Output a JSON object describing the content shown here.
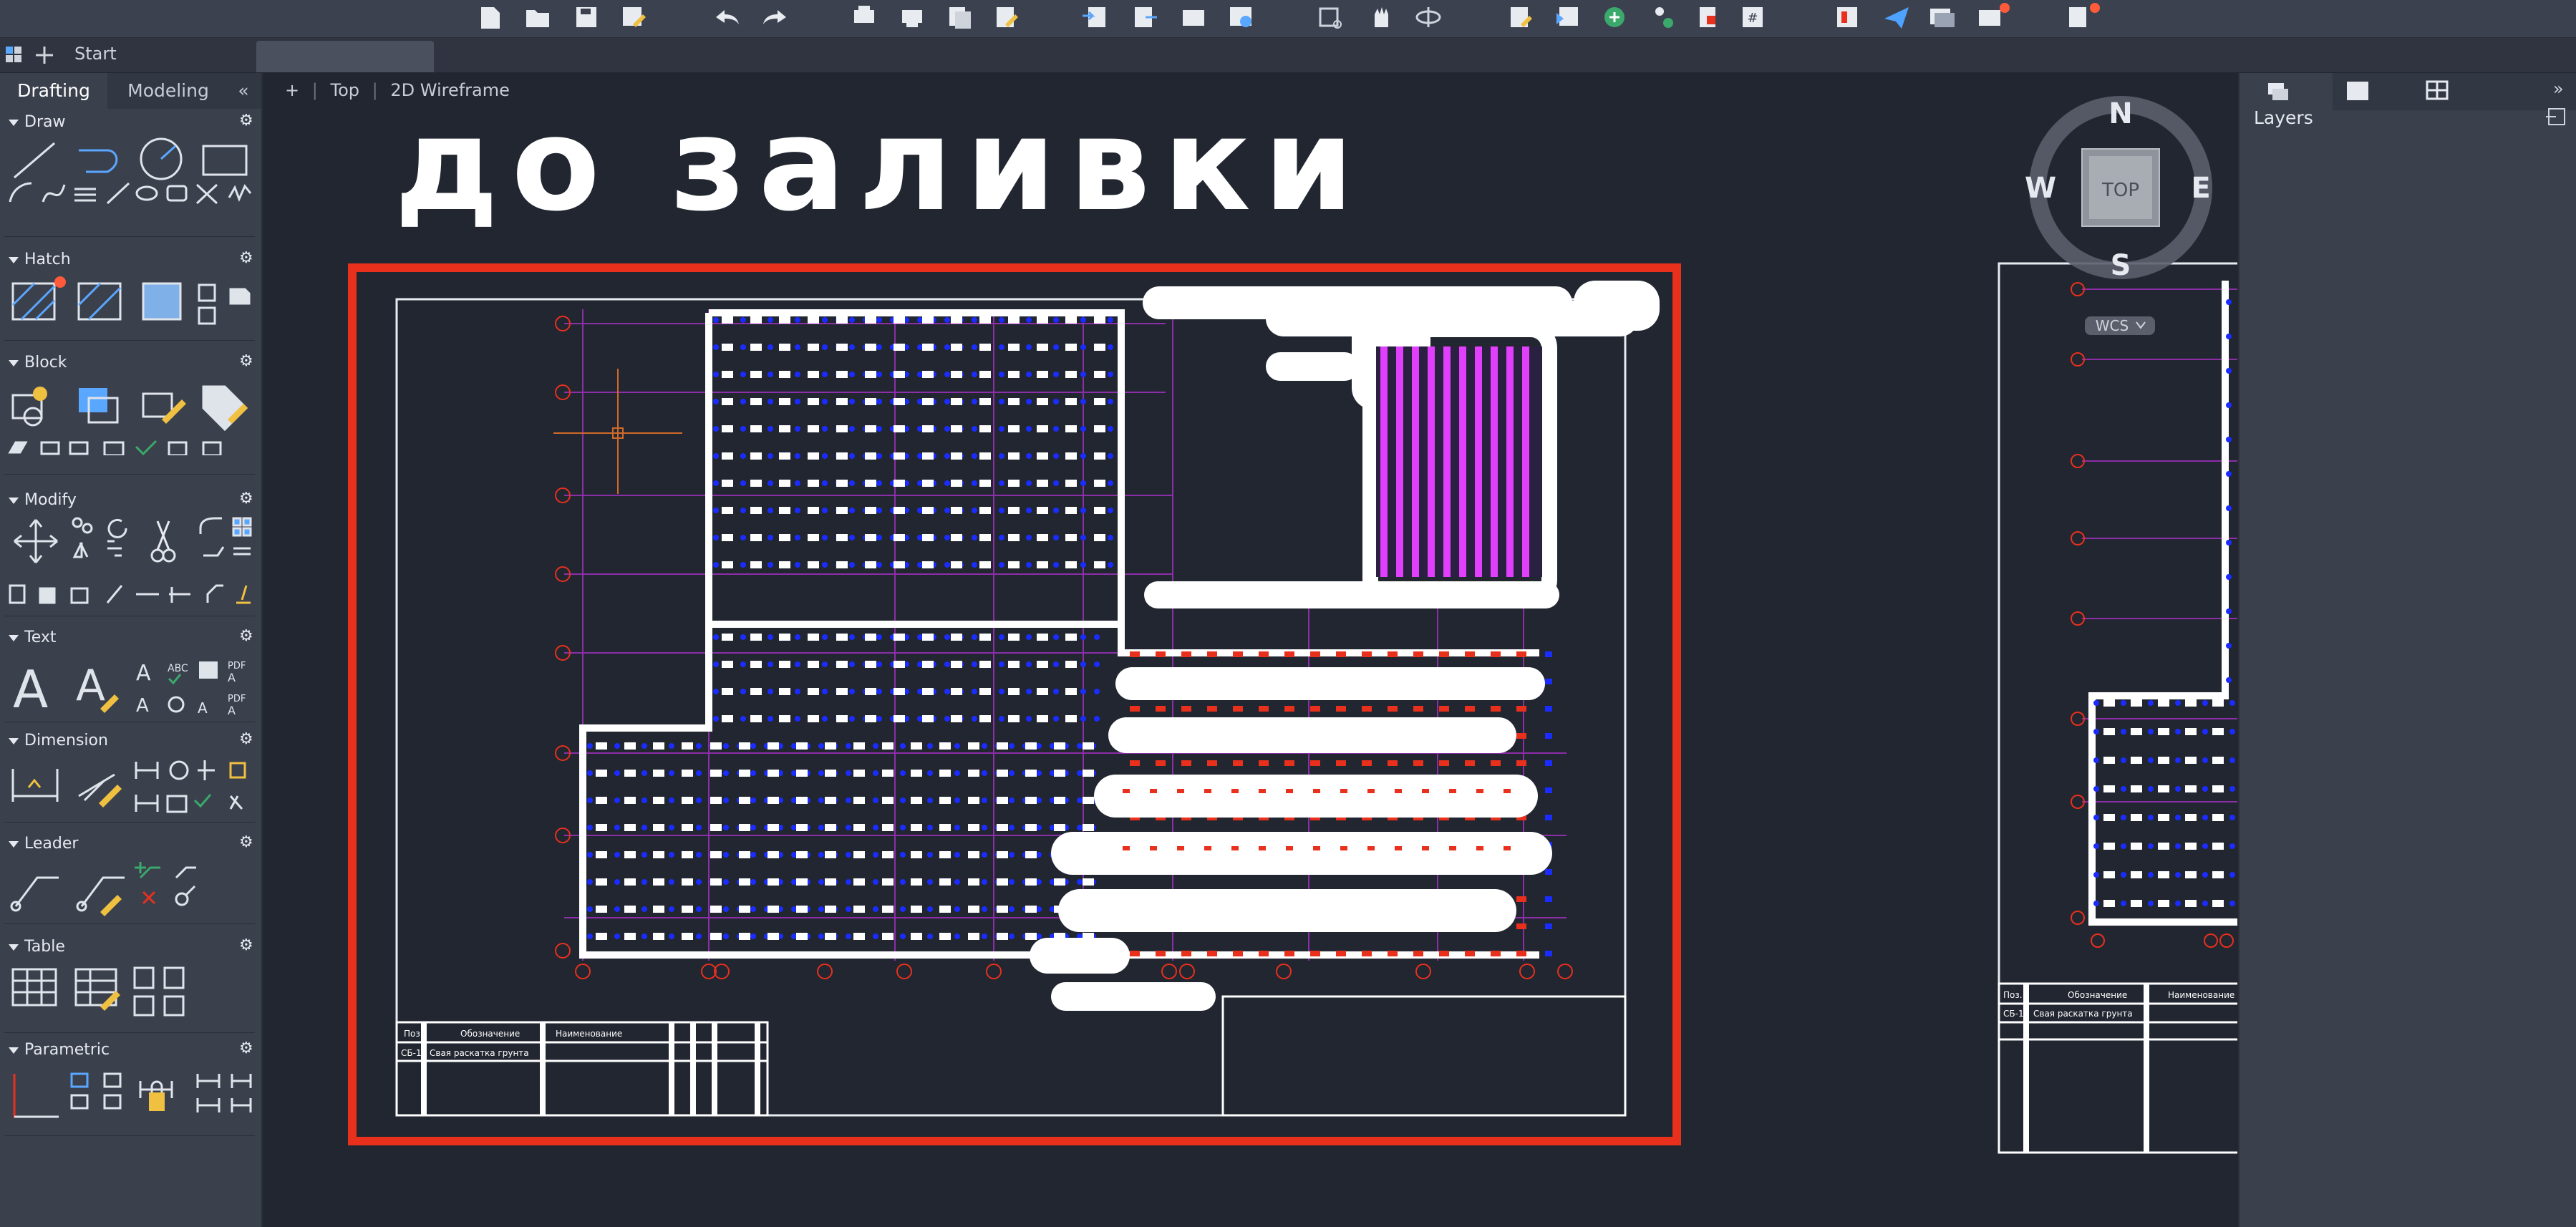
{
  "toolbar": {
    "icons": [
      "new-icon",
      "open-icon",
      "save-icon",
      "save-as-icon",
      "undo-icon",
      "redo-icon",
      "plot-icon",
      "batch-plot-icon",
      "publish-icon",
      "preview-icon",
      "import-icon",
      "export-icon",
      "attach-icon",
      "share-icon",
      "zoom-window-icon",
      "pan-icon",
      "orbit-icon",
      "properties-icon",
      "layer-icon",
      "render-icon",
      "match-icon",
      "design-center-icon",
      "quick-calc-icon",
      "sheet-set-icon",
      "send-icon",
      "window-icon",
      "notifications-icon",
      "settings-icon"
    ]
  },
  "tabs": {
    "start_label": "Start"
  },
  "palette": {
    "tab_drafting": "Drafting",
    "tab_modeling": "Modeling",
    "collapse_glyph": "«",
    "sections": {
      "draw": "Draw",
      "hatch": "Hatch",
      "block": "Block",
      "modify": "Modify",
      "text": "Text",
      "dimension": "Dimension",
      "leader": "Leader",
      "table": "Table",
      "parametric": "Parametric"
    }
  },
  "viewport": {
    "plus": "+",
    "view_name": "Top",
    "visual_style": "2D Wireframe",
    "heading_text": "до заливки",
    "viewcube": {
      "north": "N",
      "south": "S",
      "east": "E",
      "west": "W",
      "face": "TOP",
      "ucs": "WCS"
    },
    "title_block_headers": [
      "Поз.",
      "Обозначение",
      "Наименование"
    ],
    "title_block_row": [
      "СБ-1",
      "Свая  раскатка  грунта"
    ]
  },
  "right_panel": {
    "title": "Layers",
    "collapse_glyph": "»"
  },
  "colors": {
    "accent_red": "#e8301d",
    "grid_blue": "#1a2cff",
    "magenta": "#e040fb",
    "purple_line": "#8b2ea8",
    "background": "#212630"
  }
}
